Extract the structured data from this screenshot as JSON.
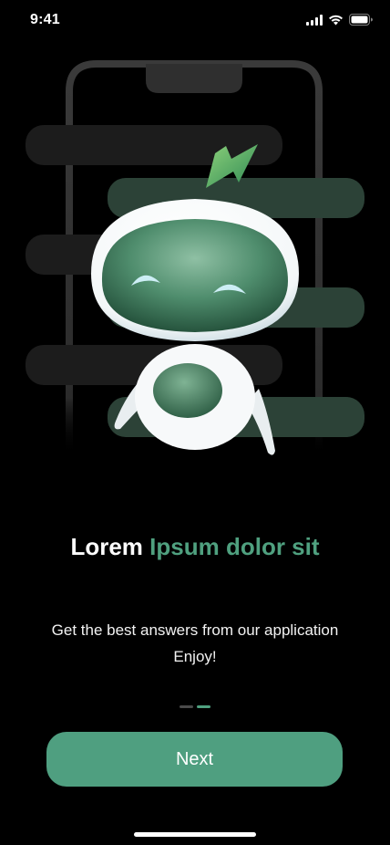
{
  "status_bar": {
    "time": "9:41",
    "icons": [
      "cellular-signal-icon",
      "wifi-icon",
      "battery-icon"
    ]
  },
  "illustration": {
    "subject": "robot-mascot",
    "phone": "phone-outline",
    "accent_color": "#4f9f80"
  },
  "onboarding": {
    "title_lead": "Lorem",
    "title_accent": "Ipsum dolor sit",
    "subtitle_line1": "Get the best answers from our application",
    "subtitle_line2": "Enjoy!",
    "page_count": 2,
    "current_page": 2
  },
  "actions": {
    "next_label": "Next"
  },
  "colors": {
    "background": "#000000",
    "accent": "#4fa07f",
    "button": "#4f9f80"
  }
}
